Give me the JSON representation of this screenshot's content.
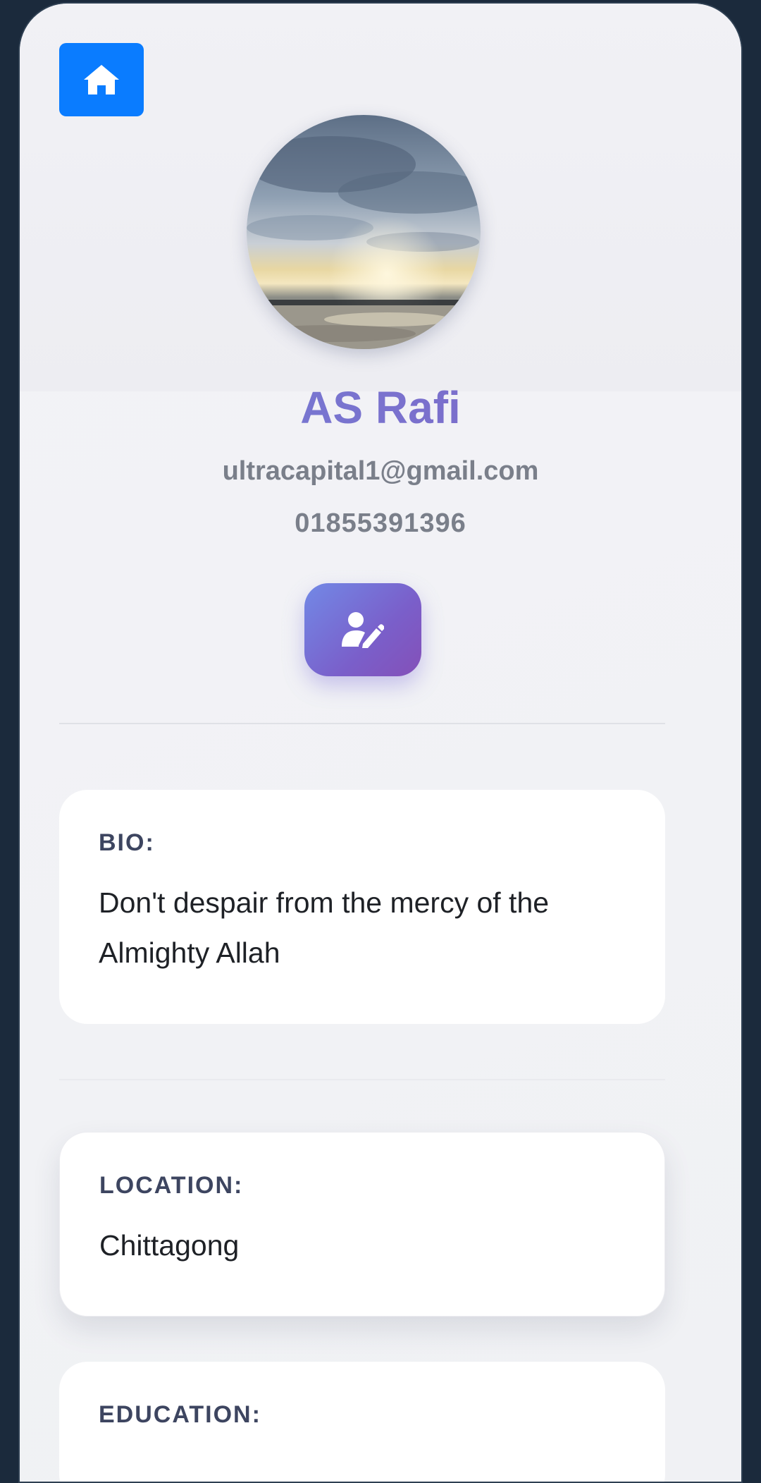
{
  "profile": {
    "name": "AS Rafi",
    "email": "ultracapital1@gmail.com",
    "phone": "01855391396"
  },
  "icons": {
    "home": "home-icon",
    "edit": "user-edit-icon"
  },
  "colors": {
    "home_button": "#0a7cff",
    "accent_gradient_start": "#7289e6",
    "accent_gradient_end": "#8450b8",
    "name": "#7b72d0"
  },
  "sections": {
    "bio": {
      "label": "BIO:",
      "value": "Don't despair from the mercy of the Almighty Allah"
    },
    "location": {
      "label": "LOCATION:",
      "value": "Chittagong"
    },
    "education": {
      "label": "EDUCATION:"
    }
  }
}
